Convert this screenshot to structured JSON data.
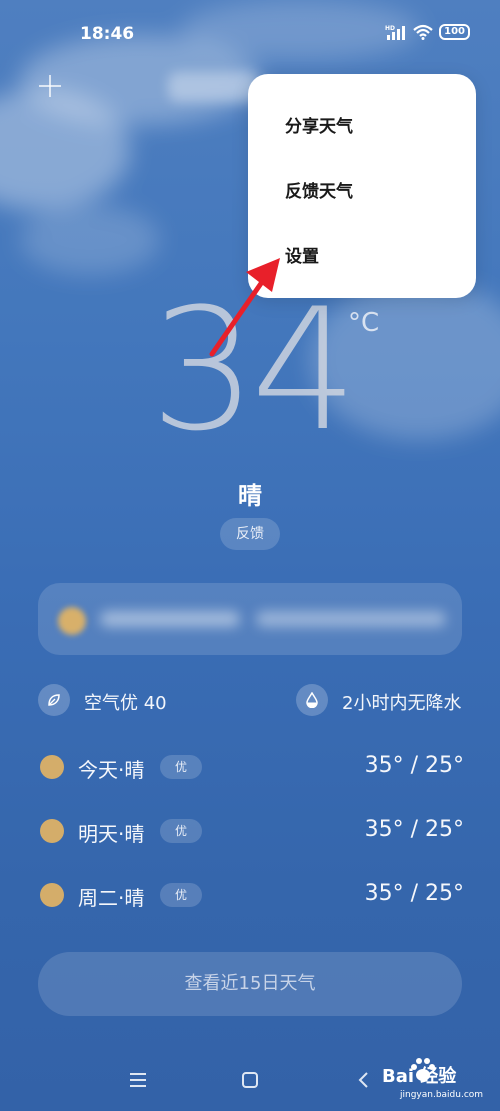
{
  "status_bar": {
    "time": "18:46",
    "network_label": "HD",
    "battery": "100"
  },
  "menu": {
    "items": [
      "分享天气",
      "反馈天气",
      "设置"
    ]
  },
  "weather": {
    "temperature": "34",
    "unit": "°C",
    "condition": "晴",
    "feedback_label": "反馈"
  },
  "indicators": {
    "air_quality": "空气优 40",
    "precipitation": "2小时内无降水"
  },
  "forecast": [
    {
      "day": "今天·晴",
      "badge": "优",
      "temps": "35° / 25°"
    },
    {
      "day": "明天·晴",
      "badge": "优",
      "temps": "35° / 25°"
    },
    {
      "day": "周二·晴",
      "badge": "优",
      "temps": "35° / 25°"
    }
  ],
  "button_15day": "查看近15日天气",
  "watermark": {
    "brand": "Bai 经验",
    "url": "jingyan.baidu.com"
  },
  "colors": {
    "background": "#4377bc",
    "sun_dot": "#d4ad6a",
    "arrow": "#e8202a",
    "menu_bg": "#ffffff"
  },
  "icons": [
    "plus-icon",
    "signal-icon",
    "wifi-icon",
    "battery-icon",
    "leaf-icon",
    "water-drop-icon",
    "menu-nav-icon",
    "home-nav-icon",
    "back-nav-icon",
    "paw-icon"
  ]
}
